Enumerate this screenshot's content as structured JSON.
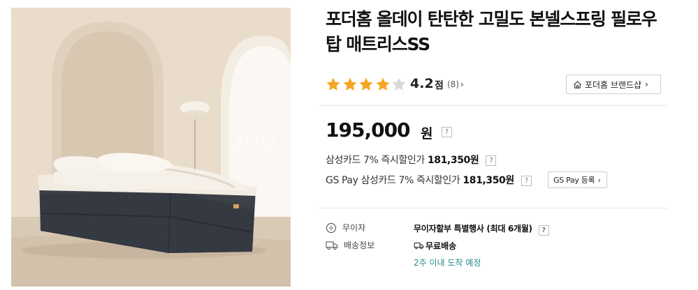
{
  "product": {
    "title": "포더홈 올데이 탄탄한 고밀도 본넬스프링 필로우탑 매트리스SS",
    "image_alt": "mattress-photo",
    "watermark": "Joo"
  },
  "rating": {
    "value": "4.2",
    "unit": "점",
    "count": "(8)",
    "stars_filled": 4,
    "stars_total": 5
  },
  "brand_shop": {
    "label": "포더홈 브랜드샵",
    "icon": "home-icon"
  },
  "price": {
    "amount": "195,000",
    "unit": "원",
    "help": "?"
  },
  "card_discounts": [
    {
      "label": "삼성카드 7% 즉시할인가",
      "amount": "181,350원",
      "help": "?"
    },
    {
      "label": "GS Pay 삼성카드 7% 즉시할인가",
      "amount": "181,350원",
      "help": "?"
    }
  ],
  "gspay_register": {
    "label": "GS Pay 등록"
  },
  "installment": {
    "label": "무이자",
    "value": "무이자할부 특별행사 (최대 6개월)",
    "help": "?"
  },
  "shipping": {
    "label": "배송정보",
    "value": "무료배송",
    "eta": "2주 이내 도착 예정"
  },
  "colors": {
    "star_filled": "#f5a623",
    "star_empty": "#d9d9d9",
    "eta_text": "#2a8a8a"
  }
}
